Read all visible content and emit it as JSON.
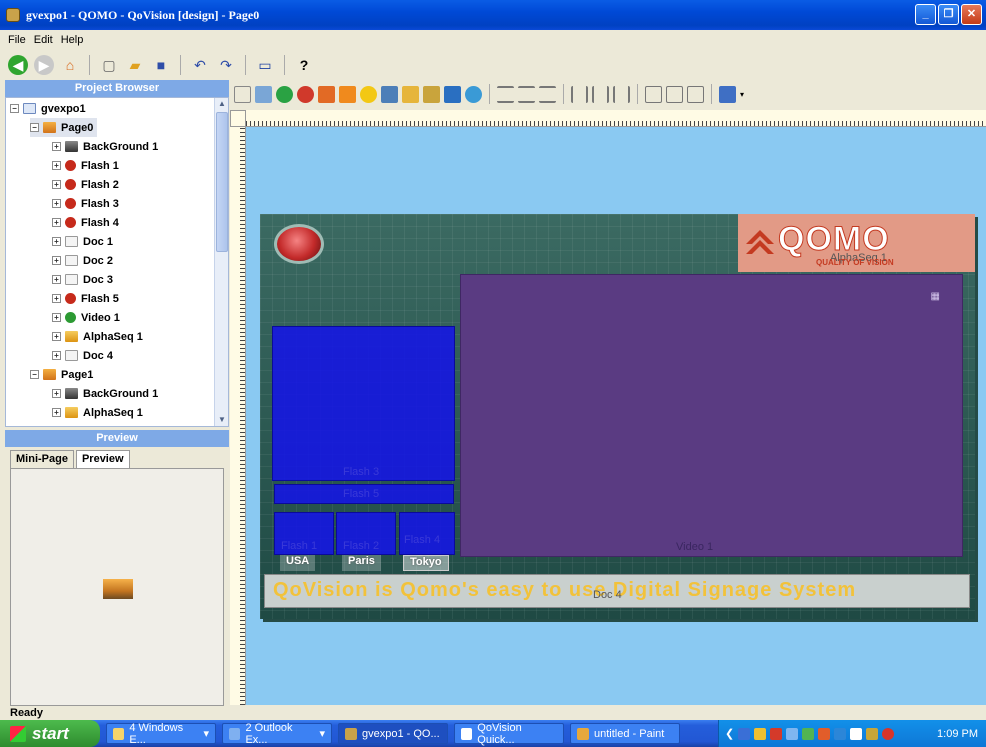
{
  "window": {
    "title": "gvexpo1 - QOMO - QoVision [design] - Page0",
    "controls": [
      "_",
      "❐",
      "✕"
    ]
  },
  "menu": {
    "items": [
      "File",
      "Edit",
      "Help"
    ]
  },
  "toolbar": {
    "buttons": [
      "back-icon",
      "forward-icon",
      "home-icon",
      "new-icon",
      "open-icon",
      "save-icon",
      "undo-icon",
      "redo-icon",
      "monitor-icon",
      "help-icon"
    ],
    "help_glyph": "?"
  },
  "project_browser": {
    "header": "Project Browser",
    "project": "gvexpo1",
    "items": [
      {
        "label": "Page0",
        "type": "page"
      },
      {
        "label": "BackGround 1",
        "type": "bg"
      },
      {
        "label": "Flash 1",
        "type": "flash"
      },
      {
        "label": "Flash 2",
        "type": "flash"
      },
      {
        "label": "Flash 3",
        "type": "flash"
      },
      {
        "label": "Flash 4",
        "type": "flash"
      },
      {
        "label": "Doc 1",
        "type": "doc"
      },
      {
        "label": "Doc 2",
        "type": "doc"
      },
      {
        "label": "Doc 3",
        "type": "doc"
      },
      {
        "label": "Flash 5",
        "type": "flash"
      },
      {
        "label": "Video 1",
        "type": "video"
      },
      {
        "label": "AlphaSeq 1",
        "type": "alpha"
      },
      {
        "label": "Doc 4",
        "type": "doc"
      },
      {
        "label": "Page1",
        "type": "page"
      },
      {
        "label": "BackGround 1",
        "type": "bg"
      },
      {
        "label": "AlphaSeq 1",
        "type": "alpha"
      }
    ]
  },
  "preview": {
    "header": "Preview",
    "tabs": [
      "Mini-Page",
      "Preview"
    ]
  },
  "design": {
    "logo_word": "QOMO",
    "logo_sub": "QUALITY OF VISION",
    "logo_label": "AlphaSeq 1",
    "video_label": "Video 1",
    "flash3": "Flash 3",
    "flash5": "Flash 5",
    "flash1": "Flash 1",
    "flash2": "Flash 2",
    "flash4": "Flash 4",
    "cities": [
      "USA",
      "Paris",
      "Tokyo"
    ],
    "ticker": "QoVision is Qomo's easy to use Digital Signage System",
    "ticker_doc": "Doc 4"
  },
  "status": "Ready",
  "taskbar": {
    "start": "start",
    "tasks": [
      "4 Windows E...",
      "2 Outlook Ex...",
      "gvexpo1 - QO...",
      "QoVision Quick...",
      "untitled - Paint"
    ],
    "clock": "1:09 PM"
  },
  "colors": {
    "canvas": "#8ac9f2",
    "accent": "#7ea9e6",
    "video": "#5a3b82",
    "flash": "#1414e6"
  }
}
